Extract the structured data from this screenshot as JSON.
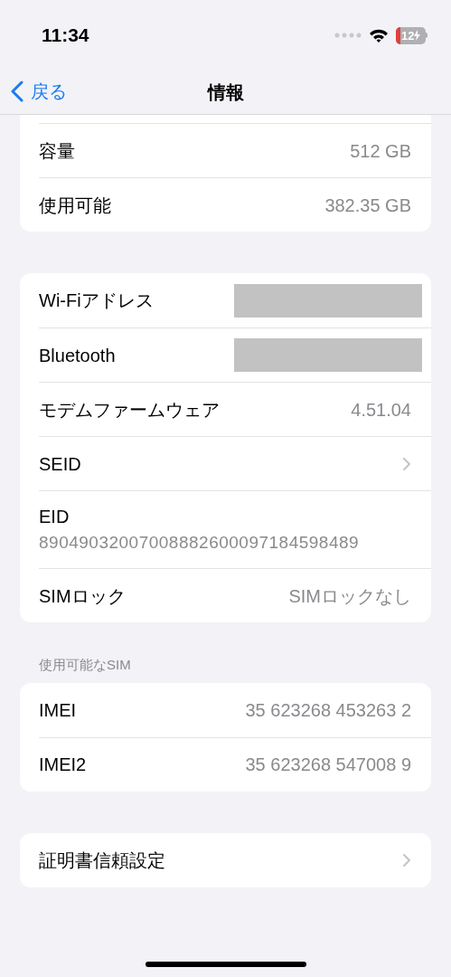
{
  "status_bar": {
    "time": "11:34",
    "battery": "12"
  },
  "nav": {
    "back": "戻る",
    "title": "情報"
  },
  "sections": [
    {
      "cut_top": true,
      "rows": [
        {
          "kind": "value",
          "label": "容量",
          "value": "512 GB"
        },
        {
          "kind": "value",
          "label": "使用可能",
          "value": "382.35 GB"
        }
      ]
    },
    {
      "rows": [
        {
          "kind": "redacted",
          "label": "Wi-Fiアドレス"
        },
        {
          "kind": "redacted",
          "label": "Bluetooth"
        },
        {
          "kind": "value",
          "label": "モデムファームウェア",
          "value": "4.51.04"
        },
        {
          "kind": "link",
          "label": "SEID"
        },
        {
          "kind": "stacked",
          "label": "EID",
          "value": "89049032007008882600097184598489"
        },
        {
          "kind": "value",
          "label": "SIMロック",
          "value": "SIMロックなし"
        }
      ]
    },
    {
      "header": "使用可能なSIM",
      "rows": [
        {
          "kind": "value",
          "label": "IMEI",
          "value": "35 623268 453263 2"
        },
        {
          "kind": "value",
          "label": "IMEI2",
          "value": "35 623268 547008 9"
        }
      ]
    },
    {
      "rows": [
        {
          "kind": "link",
          "label": "証明書信頼設定"
        }
      ]
    }
  ]
}
